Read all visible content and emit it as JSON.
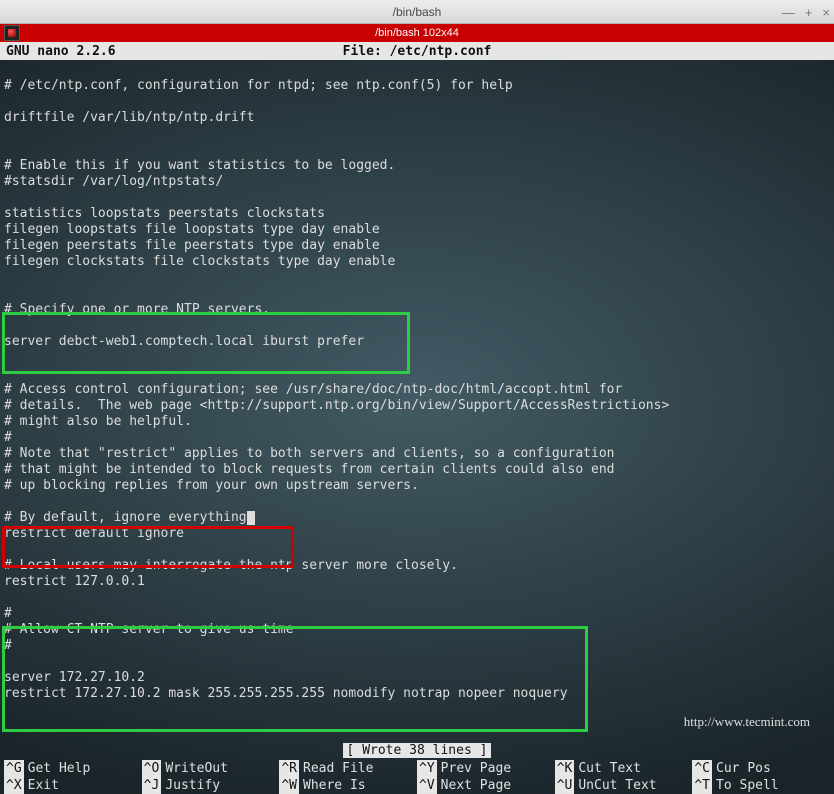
{
  "window": {
    "title": "/bin/bash",
    "controls": {
      "min": "—",
      "max": "+",
      "close": "×"
    }
  },
  "redbar": {
    "tabtitle": "/bin/bash 102x44"
  },
  "nano": {
    "version": "  GNU nano 2.2.6",
    "file_label": "File: /etc/ntp.conf"
  },
  "file_lines": [
    "",
    "# /etc/ntp.conf, configuration for ntpd; see ntp.conf(5) for help",
    "",
    "driftfile /var/lib/ntp/ntp.drift",
    "",
    "",
    "# Enable this if you want statistics to be logged.",
    "#statsdir /var/log/ntpstats/",
    "",
    "statistics loopstats peerstats clockstats",
    "filegen loopstats file loopstats type day enable",
    "filegen peerstats file peerstats type day enable",
    "filegen clockstats file clockstats type day enable",
    "",
    "",
    "# Specify one or more NTP servers.",
    "",
    "server debct-web1.comptech.local iburst prefer",
    "",
    "",
    "# Access control configuration; see /usr/share/doc/ntp-doc/html/accopt.html for",
    "# details.  The web page <http://support.ntp.org/bin/view/Support/AccessRestrictions>",
    "# might also be helpful.",
    "#",
    "# Note that \"restrict\" applies to both servers and clients, so a configuration",
    "# that might be intended to block requests from certain clients could also end",
    "# up blocking replies from your own upstream servers.",
    "",
    "# By default, ignore everything",
    "restrict default ignore",
    "",
    "# Local users may interrogate the ntp server more closely.",
    "restrict 127.0.0.1",
    "",
    "#",
    "# Allow CT NTP server to give us time",
    "#",
    "",
    "server 172.27.10.2",
    "restrict 172.27.10.2 mask 255.255.255.255 nomodify notrap nopeer noquery"
  ],
  "cursor_line_index": 28,
  "status": "[ Wrote 38 lines ]",
  "tecmint": "http://www.tecmint.com",
  "shortcuts": {
    "row1": [
      {
        "key": "^G",
        "label": "Get Help"
      },
      {
        "key": "^O",
        "label": "WriteOut"
      },
      {
        "key": "^R",
        "label": "Read File"
      },
      {
        "key": "^Y",
        "label": "Prev Page"
      },
      {
        "key": "^K",
        "label": "Cut Text"
      },
      {
        "key": "^C",
        "label": "Cur Pos"
      }
    ],
    "row2": [
      {
        "key": "^X",
        "label": "Exit"
      },
      {
        "key": "^J",
        "label": "Justify"
      },
      {
        "key": "^W",
        "label": "Where Is"
      },
      {
        "key": "^V",
        "label": "Next Page"
      },
      {
        "key": "^U",
        "label": "UnCut Text"
      },
      {
        "key": "^T",
        "label": "To Spell"
      }
    ]
  }
}
